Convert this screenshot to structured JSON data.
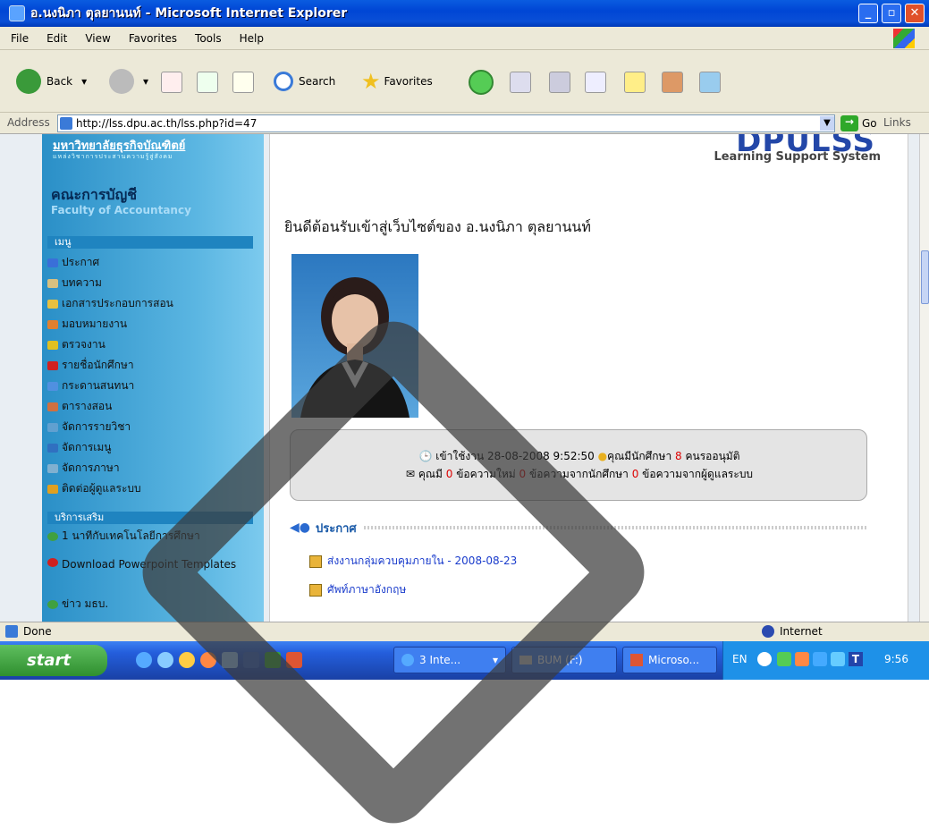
{
  "window": {
    "title": "อ.นงนิภา ตุลยานนท์ - Microsoft Internet Explorer"
  },
  "menubar": [
    "File",
    "Edit",
    "View",
    "Favorites",
    "Tools",
    "Help"
  ],
  "toolbar": {
    "back": "Back",
    "search": "Search",
    "favorites": "Favorites"
  },
  "address": {
    "label": "Address",
    "url": "http://lss.dpu.ac.th/lss.php?id=47",
    "go": "Go",
    "links": "Links"
  },
  "sidebar": {
    "university": "มหาวิทยาลัยธุรกิจบัณฑิตย์",
    "university_sub": "แหล่งวิชาการประสานความรู้สู่สังคม",
    "faculty_th": "คณะการบัญชี",
    "faculty_en": "Faculty of Accountancy",
    "menu_header": "เมนู",
    "menu": [
      {
        "label": "ประกาศ",
        "color": "#3a6fd8"
      },
      {
        "label": "บทความ",
        "color": "#d8c080"
      },
      {
        "label": "เอกสารประกอบการสอน",
        "color": "#e8c040"
      },
      {
        "label": "มอบหมายงาน",
        "color": "#e08030"
      },
      {
        "label": "ตรวจงาน",
        "color": "#e0c020"
      },
      {
        "label": "รายชื่อนักศึกษา",
        "color": "#d02020"
      },
      {
        "label": "กระดานสนทนา",
        "color": "#5090e0"
      },
      {
        "label": "ตารางสอน",
        "color": "#d07040"
      },
      {
        "label": "จัดการรายวิชา",
        "color": "#60a0d0"
      },
      {
        "label": "จัดการเมนู",
        "color": "#3070c0"
      },
      {
        "label": "จัดการภาษา",
        "color": "#80b0d0"
      },
      {
        "label": "ติดต่อผู้ดูแลระบบ",
        "color": "#e0a020"
      }
    ],
    "extra_header": "บริการเสริม",
    "extra": [
      {
        "label": "1 นาทีกับเทคโนโลยีการศึกษา",
        "color": "#40a040"
      },
      {
        "label": "Download Powerpoint Templates",
        "color": "#d02020"
      },
      {
        "label": "ข่าว มธบ.",
        "color": "#40a040"
      }
    ]
  },
  "content": {
    "brand": "DPULSS",
    "brand_sub": "Learning Support System",
    "welcome": "ยินดีต้อนรับเข้าสู่เว็บไซต์ของ อ.นงนิภา ตุลยานนท์",
    "stats": {
      "login_label": "เข้าใช้งาน",
      "login_time": "28-08-2008 9:52:50",
      "pending_label": "คุณมีนักศึกษา",
      "pending_count": "8",
      "pending_suffix": "คนรออนุมัติ",
      "msg_label": "คุณมี",
      "new_count": "0",
      "new_label": "ข้อความใหม่",
      "student_count": "0",
      "student_label": "ข้อความจากนักศึกษา",
      "admin_count": "0",
      "admin_label": "ข้อความจากผู้ดูแลระบบ"
    },
    "announce_header": "ประกาศ",
    "announcements": [
      "ส่งงานกลุ่มควบคุมภายใน - 2008-08-23",
      "ศัพท์ภาษาอังกฤษ"
    ]
  },
  "statusbar": {
    "left": "Done",
    "zone": "Internet"
  },
  "taskbar": {
    "start": "start",
    "tasks": [
      "3 Inte...",
      "BUM (F:)",
      "Microso..."
    ],
    "lang": "EN",
    "clock": "9:56"
  }
}
